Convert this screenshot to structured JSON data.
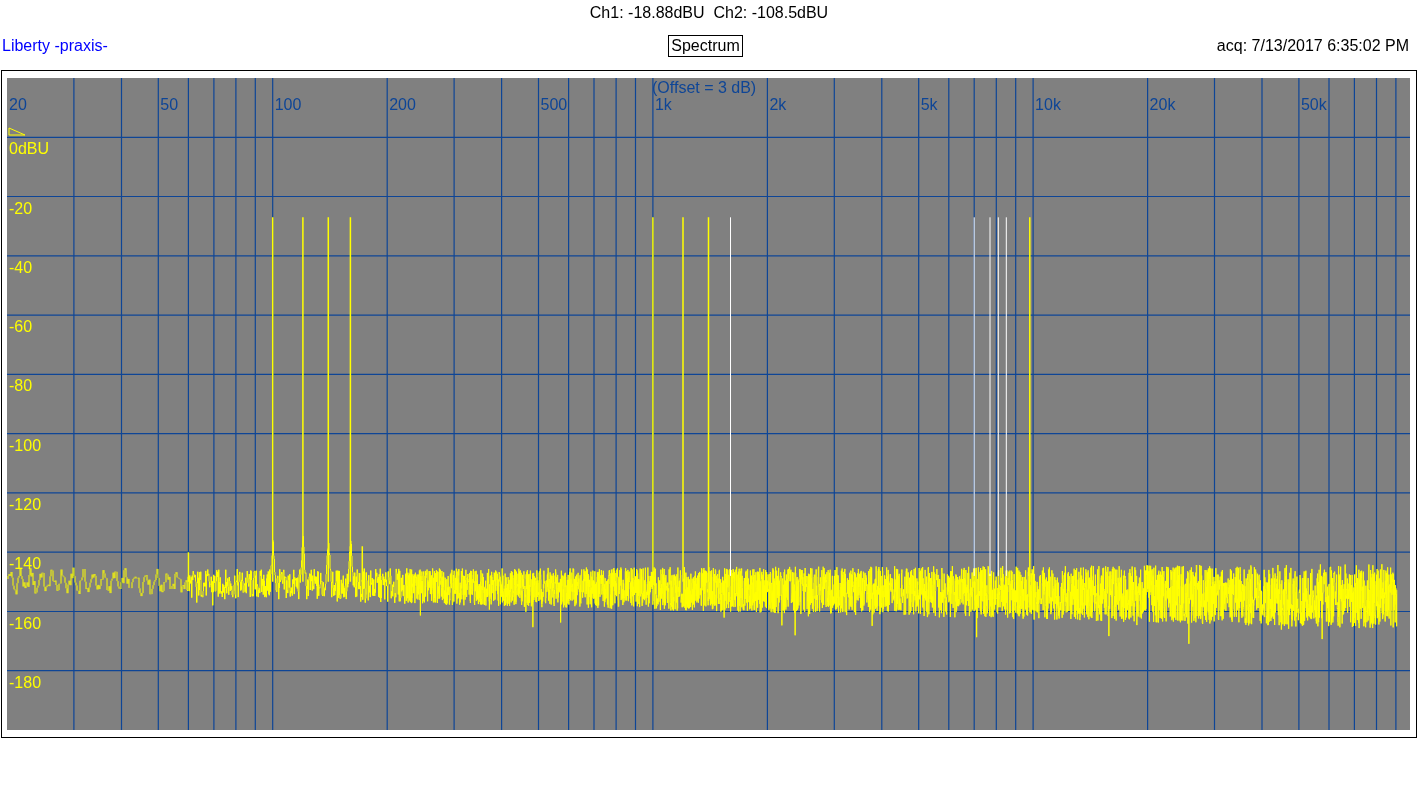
{
  "header": {
    "readout": "Ch1: -18.88dBU  Ch2: -108.5dBU",
    "app_name": "Liberty -praxis-",
    "mode": "Spectrum",
    "acquired": "acq: 7/13/2017 6:35:02 PM"
  },
  "plot": {
    "offset_note": "(Offset = 3 dB)",
    "x_tick_labels": [
      "20",
      "50",
      "100",
      "200",
      "500",
      "1k",
      "2k",
      "5k",
      "10k",
      "20k",
      "50k"
    ],
    "y_tick_labels": [
      "0dBU",
      "-20",
      "-40",
      "-60",
      "-80",
      "-100",
      "-120",
      "-140",
      "-160",
      "-180"
    ]
  }
}
